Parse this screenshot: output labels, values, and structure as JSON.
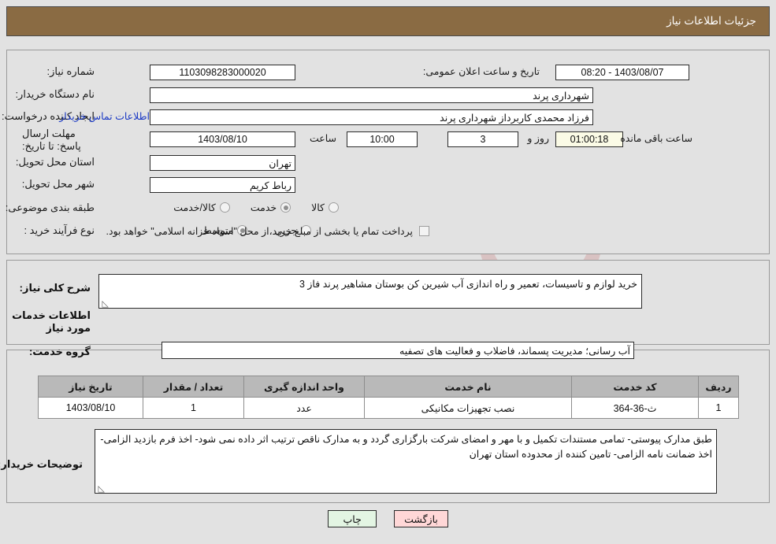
{
  "header": {
    "title": "جزئیات اطلاعات نیاز"
  },
  "watermark": {
    "text": "AriaTender.net"
  },
  "fields": {
    "need_number_label": "شماره نیاز:",
    "need_number_value": "1103098283000020",
    "announce_datetime_label": "تاریخ و ساعت اعلان عمومی:",
    "announce_datetime_value": "1403/08/07 - 08:20",
    "buyer_org_label": "نام دستگاه خریدار:",
    "buyer_org_value": "شهرداری پرند",
    "requester_label": "ایجاد کننده درخواست:",
    "requester_value": "فرزاد محمدی کاربرداز شهرداری پرند",
    "buyer_contact_link": "اطلاعات تماس خریدار",
    "deadline_label": "مهلت ارسال پاسخ: تا تاریخ:",
    "deadline_date": "1403/08/10",
    "hour_label": "ساعت",
    "deadline_time": "10:00",
    "days_value": "3",
    "days_label": "روز و",
    "countdown_value": "01:00:18",
    "remaining_label": "ساعت باقی مانده",
    "province_label": "استان محل تحویل:",
    "province_value": "تهران",
    "city_label": "شهر محل تحویل:",
    "city_value": "رباط کریم",
    "category_label": "طبقه بندی موضوعی:",
    "process_label": "نوع فرآیند خرید :",
    "treasury_note": "پرداخت تمام یا بخشی از مبلغ خرید،از محل \"اسناد خزانه اسلامی\" خواهد بود."
  },
  "category_options": [
    {
      "label": "کالا",
      "selected": false
    },
    {
      "label": "خدمت",
      "selected": true
    },
    {
      "label": "کالا/خدمت",
      "selected": false
    }
  ],
  "process_options": [
    {
      "label": "جزیی",
      "selected": false
    },
    {
      "label": "متوسط",
      "selected": true
    }
  ],
  "description": {
    "label": "شرح کلی نیاز:",
    "value": "خرید لوازم و تاسیسات، تعمیر و راه اندازی آب شیرین کن بوستان مشاهیر پرند فاز 3"
  },
  "services_section": {
    "heading": "اطلاعات خدمات مورد نیاز",
    "group_label": "گروه خدمت:",
    "group_value": "آب رسانی؛ مدیریت پسماند، فاضلاب و فعالیت های تصفیه"
  },
  "items_table": {
    "columns": [
      "ردیف",
      "کد خدمت",
      "نام خدمت",
      "واحد اندازه گیری",
      "تعداد / مقدار",
      "تاریخ نیاز"
    ],
    "rows": [
      {
        "index": "1",
        "code": "ث-36-364",
        "name": "نصب تجهیزات مکانیکی",
        "unit": "عدد",
        "quantity": "1",
        "need_date": "1403/08/10"
      }
    ]
  },
  "buyer_notes": {
    "label": "توضیحات خریدار:",
    "value": "طبق مدارک پیوستی- تمامی مستندات تکمیل و با مهر و امضای شرکت بارگزاری گردد و به مدارک ناقص ترتیب اثر داده نمی شود- اخذ فرم بازدید الزامی- اخذ ضمانت نامه الزامی- تامین کننده از محدوده استان تهران"
  },
  "buttons": {
    "back": "بازگشت",
    "print": "چاپ"
  },
  "colors": {
    "header_bar": "#8a6b43",
    "page_bg": "#e2e2e2",
    "table_header": "#b9b9b9",
    "link": "#1a39c4",
    "countdown_bg": "#fbfbe6",
    "back_btn": "#ffd7d7",
    "print_btn": "#e3f5e3"
  }
}
